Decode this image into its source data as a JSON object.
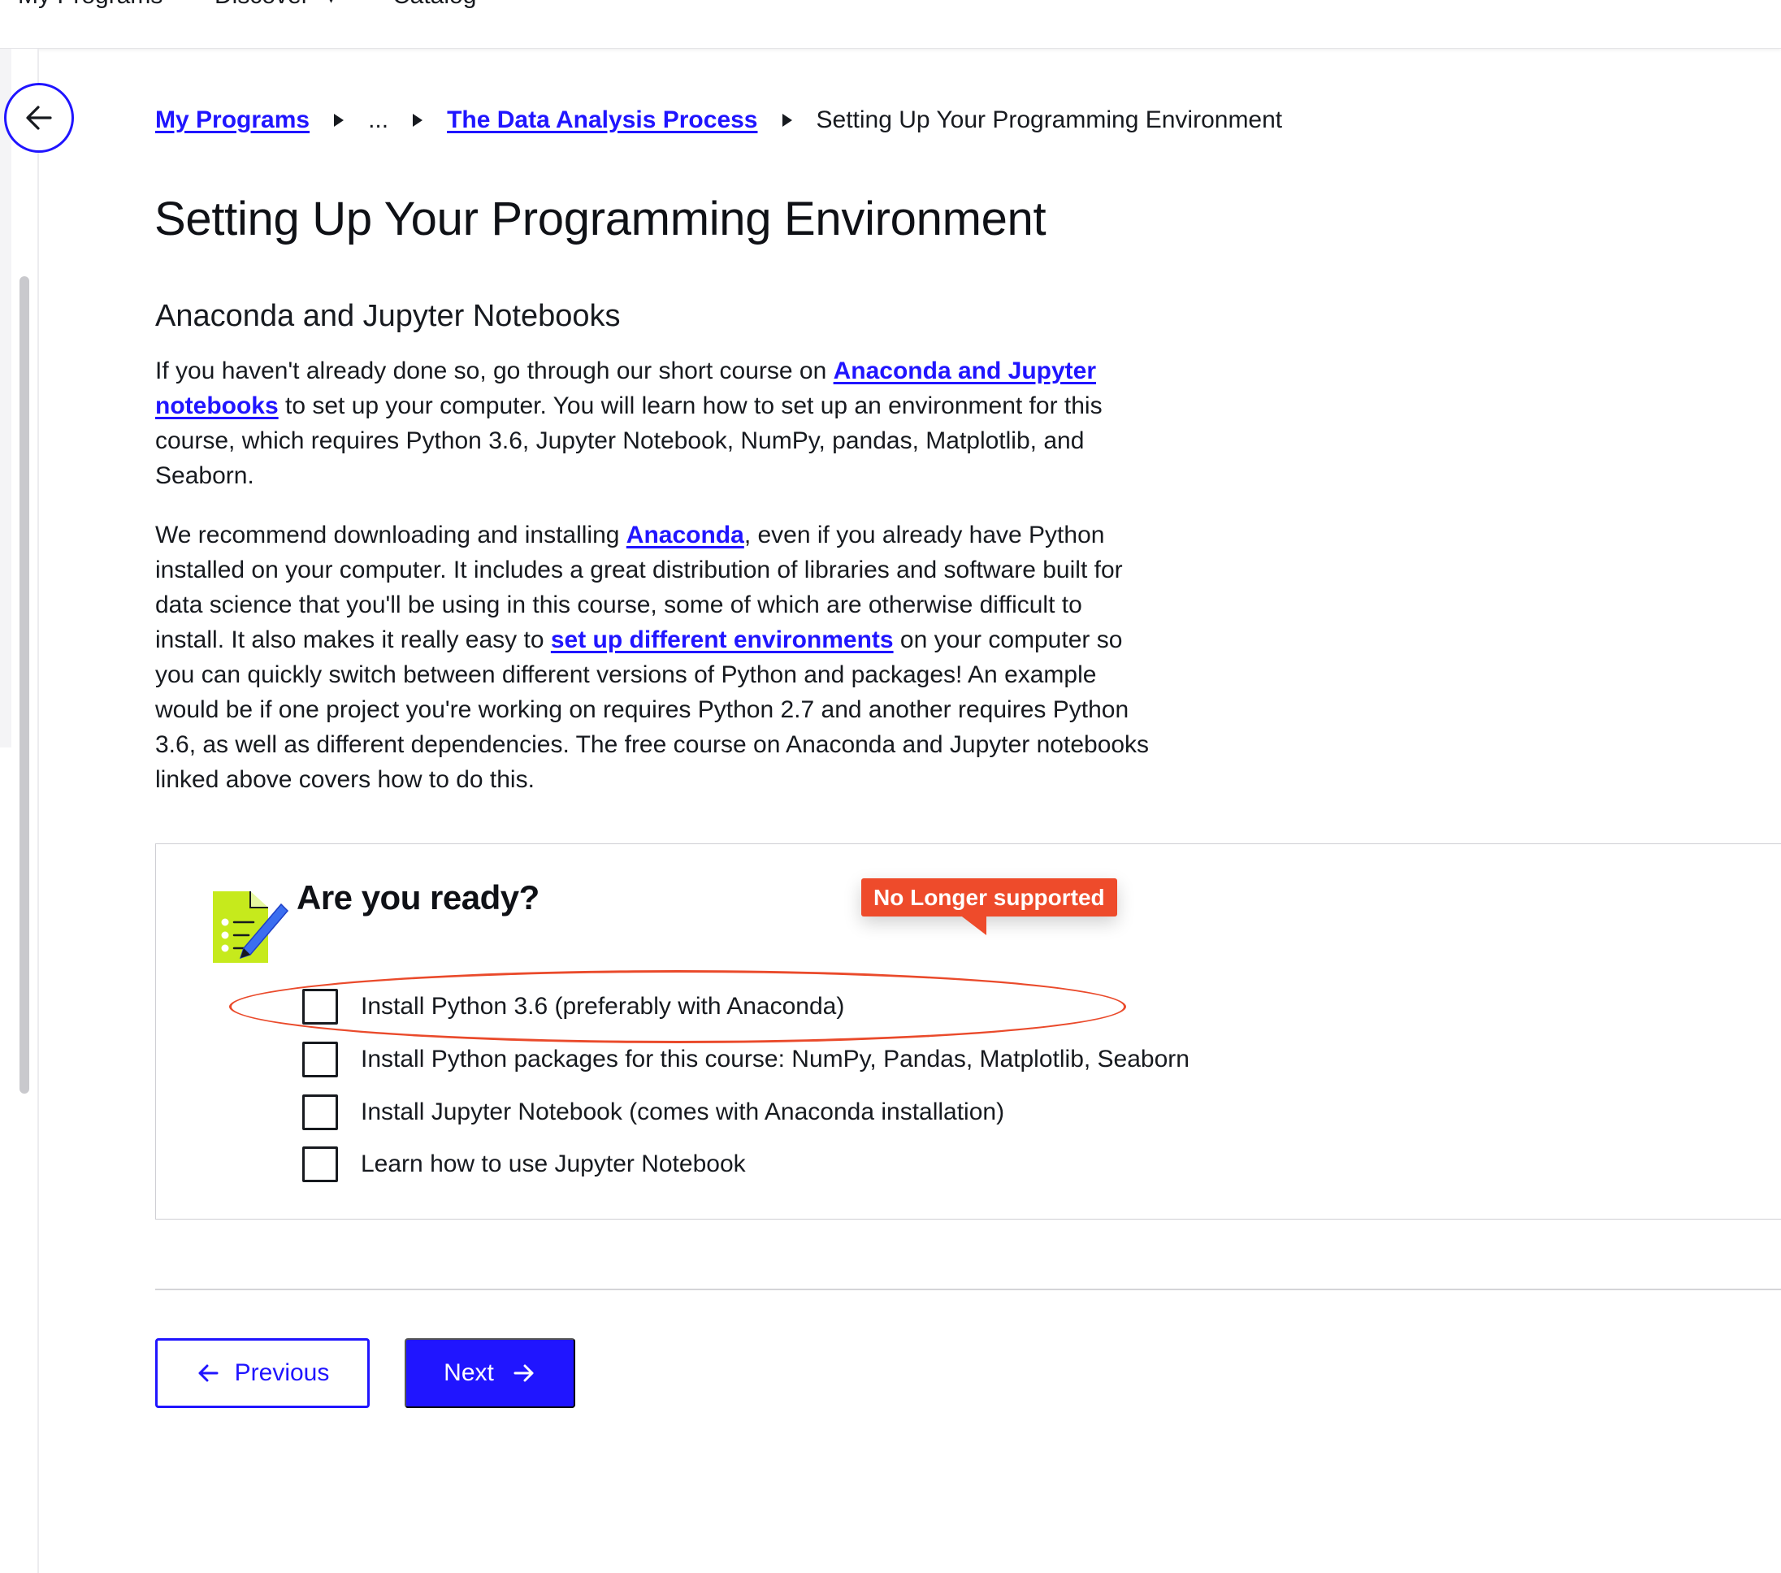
{
  "topnav": {
    "items": [
      {
        "label": "My Programs"
      },
      {
        "label": "Discover",
        "caret": "▾"
      },
      {
        "label": "Catalog"
      }
    ]
  },
  "breadcrumb": {
    "items": [
      {
        "label": "My Programs",
        "link": true
      },
      {
        "label": "...",
        "link": false
      },
      {
        "label": "The Data Analysis Process",
        "link": true
      },
      {
        "label": "Setting Up Your Programming Environment",
        "link": false
      }
    ]
  },
  "page": {
    "title": "Setting Up Your Programming Environment",
    "section_heading": "Anaconda and Jupyter Notebooks",
    "para1": {
      "t1": "If you haven't already done so, go through our short course on ",
      "link": "Anaconda and Jupyter notebooks",
      "t2": " to set up your computer. You will learn how to set up an environment for this course, which requires Python 3.6, Jupyter Notebook, NumPy, pandas, Matplotlib, and Seaborn."
    },
    "para2": {
      "t1": "We recommend downloading and installing ",
      "link1": "Anaconda",
      "t2": ", even if you already have Python installed on your computer. It includes a great distribution of libraries and software built for data science that you'll be using in this course, some of which are otherwise difficult to install. It also makes it really easy to ",
      "link2": "set up different environments",
      "t3": " on your computer so you can quickly switch between different versions of Python and packages! An example would be if one project you're working on requires Python 2.7 and another requires Python 3.6, as well as different dependencies. The free course on Anaconda and Jupyter notebooks linked above covers how to do this."
    }
  },
  "quiz": {
    "title": "Are you ready?",
    "badge": "No Longer supported",
    "items": [
      {
        "label": "Install Python 3.6 (preferably with Anaconda)",
        "checked": false
      },
      {
        "label": "Install Python packages for this course: NumPy, Pandas, Matplotlib, Seaborn",
        "checked": false
      },
      {
        "label": "Install Jupyter Notebook (comes with Anaconda installation)",
        "checked": false
      },
      {
        "label": "Learn how to use Jupyter Notebook",
        "checked": false
      }
    ]
  },
  "nav_buttons": {
    "previous": "Previous",
    "next": "Next"
  },
  "icons": [
    "back-arrow-icon",
    "breadcrumb-separator-icon",
    "checklist-icon",
    "arrow-left-icon",
    "arrow-right-icon",
    "caret-down-icon"
  ],
  "colors": {
    "accent": "#2015ff",
    "badge": "#ee4b2b",
    "annotation": "#ea4a2b",
    "icon_green": "#c6ea1c",
    "icon_pen": "#3b6ef0",
    "text": "#171a1f"
  }
}
